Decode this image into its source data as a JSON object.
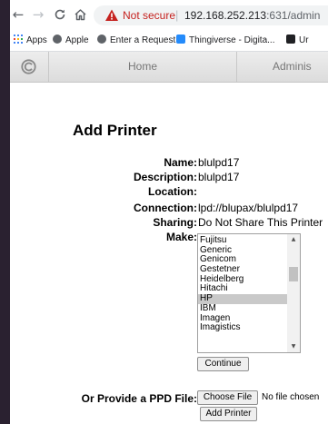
{
  "browser": {
    "back_icon": "←",
    "forward_icon": "→",
    "reload_icon": "C",
    "home_icon": "⌂",
    "security_label": "Not secure",
    "url_host": "192.168.252.213",
    "url_rest": ":631/admin",
    "separator": "|"
  },
  "bookmarks": [
    {
      "label": "Apps",
      "icon": "apps-grid-icon",
      "color": "#4285f4"
    },
    {
      "label": "Apple",
      "icon": "apple-logo-icon",
      "color": "#5f6368"
    },
    {
      "label": "Enter a Request",
      "icon": "request-icon",
      "color": "#5f6368"
    },
    {
      "label": "Thingiverse - Digita...",
      "icon": "thingiverse-icon",
      "color": "#248bfb"
    },
    {
      "label": "Ur",
      "icon": "bookmark-icon",
      "color": "#202124"
    }
  ],
  "tabs": [
    {
      "label": "Home"
    },
    {
      "label": "Adminis"
    }
  ],
  "page": {
    "title": "Add Printer"
  },
  "fields": [
    {
      "label": "Name:",
      "value": "blulpd17"
    },
    {
      "label": "Description:",
      "value": "blulpd17"
    },
    {
      "label": "Location:",
      "value": ""
    },
    {
      "label": "Connection:",
      "value": "lpd://blupax/blulpd17"
    },
    {
      "label": "Sharing:",
      "value": "Do Not Share This Printer"
    }
  ],
  "make": {
    "label": "Make:",
    "options": [
      "Fujitsu",
      "Generic",
      "Genicom",
      "Gestetner",
      "Heidelberg",
      "Hitachi",
      "HP",
      "IBM",
      "Imagen",
      "Imagistics"
    ],
    "selected": "HP"
  },
  "buttons": {
    "continue": "Continue",
    "choose_file": "Choose File",
    "add_printer": "Add Printer"
  },
  "ppd": {
    "label": "Or Provide a PPD File:",
    "no_file": "No file chosen"
  },
  "colors": {
    "not_secure": "#c5221f",
    "selected_option": "#c9c9c9",
    "window_frame": "#2a2130"
  }
}
